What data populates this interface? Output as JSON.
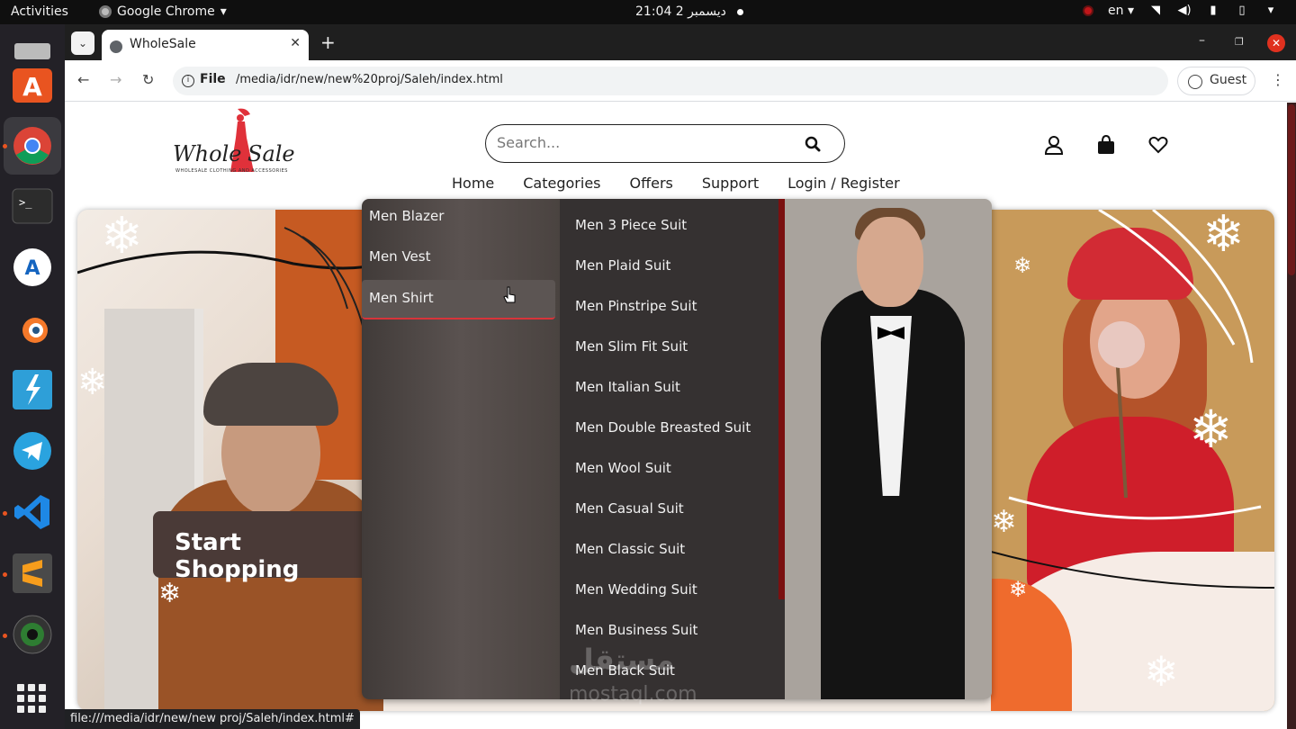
{
  "os": {
    "activities": "Activities",
    "app_name": "Google Chrome",
    "clock": "21:04  2 ديسمبر",
    "lang": "en"
  },
  "browser": {
    "tab_title": "WholeSale",
    "new_tab": "+",
    "url_scheme": "File",
    "url": "/media/idr/new/new%20proj/Saleh/index.html",
    "profile": "Guest",
    "status_url": "file:///media/idr/new/new proj/Saleh/index.html#"
  },
  "site": {
    "logo_word1": "Whole",
    "logo_word2": "Sale",
    "logo_tagline": "WHOLESALE CLOTHING AND ACCESSORIES",
    "search_placeholder": "Search...",
    "nav": [
      "Home",
      "Categories",
      "Offers",
      "Support",
      "Login / Register"
    ],
    "cta": "Start Shopping"
  },
  "dropdown": {
    "categories": [
      "Men Blazer",
      "Men Vest",
      "Men Shirt"
    ],
    "selected_index": 2,
    "subcategories": [
      "Men 3 Piece Suit",
      "Men Plaid Suit",
      "Men Pinstripe Suit",
      "Men Slim Fit Suit",
      "Men Italian Suit",
      "Men Double Breasted Suit",
      "Men Wool Suit",
      "Men Casual Suit",
      "Men Classic Suit",
      "Men Wedding Suit",
      "Men Business Suit",
      "Men Black Suit"
    ]
  },
  "watermark": {
    "line1": "مستقل",
    "line2": "mostaql.com"
  },
  "colors": {
    "accent": "#d8343a",
    "brand_red": "#e0313a",
    "dropdown_bg": "#353131"
  }
}
